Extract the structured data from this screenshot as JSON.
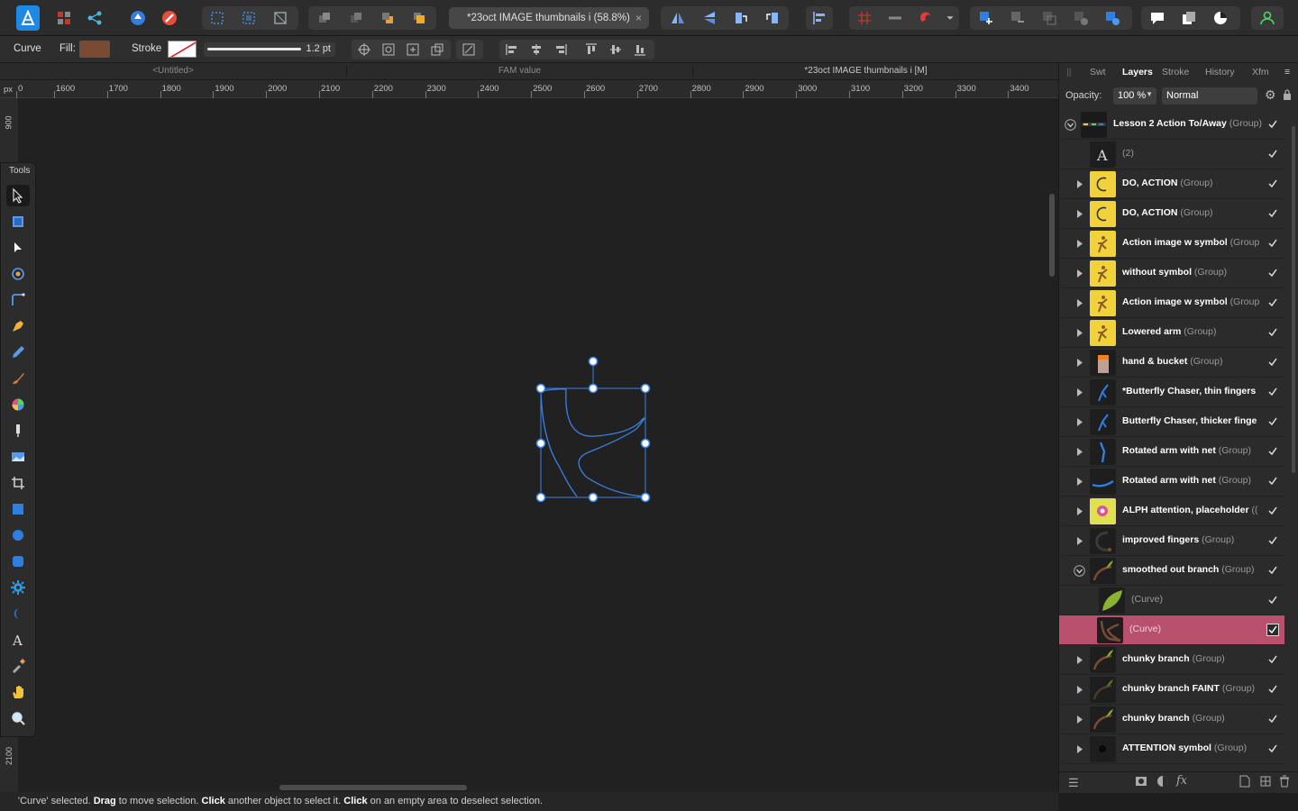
{
  "toolbar": {
    "document_tab": "*23oct IMAGE thumbnails i (58.8%)",
    "close_symbol": "×"
  },
  "context": {
    "tool_label": "Curve",
    "fill_label": "Fill:",
    "stroke_label": "Stroke",
    "stroke_width": "1.2 pt",
    "fill_color": "#7a4a33"
  },
  "doctabs": [
    "<Untitled>",
    "FAM value",
    "*23oct IMAGE thumbnails i [M]"
  ],
  "ruler": {
    "unit": "px",
    "h_ticks": [
      "0",
      "1600",
      "1700",
      "1800",
      "1900",
      "2000",
      "2100",
      "2200",
      "2300",
      "2400",
      "2500",
      "2600",
      "2700",
      "2800",
      "2900",
      "3000",
      "3100",
      "3200",
      "3300",
      "3400"
    ],
    "v_ticks": [
      "900",
      "2100"
    ]
  },
  "tools": {
    "title": "Tools"
  },
  "panel": {
    "tabs": [
      "Swt",
      "Layers",
      "Stroke",
      "History",
      "Xfm"
    ],
    "active_tab": "Layers",
    "opacity_label": "Opacity:",
    "opacity_value": "100 %",
    "blend_mode": "Normal"
  },
  "layers": [
    {
      "name": "Lesson 2 Action To/Away",
      "suffix": "(Group)",
      "expanded": true,
      "indent": 0,
      "thumb": "dark-strip"
    },
    {
      "name": "(2)",
      "suffix": "",
      "expanded": false,
      "indent": 1,
      "thumb": "text",
      "plain": true
    },
    {
      "name": "DO, ACTION",
      "suffix": "(Group)",
      "indent": 1,
      "thumb": "yellow-c"
    },
    {
      "name": "DO, ACTION",
      "suffix": "(Group)",
      "indent": 1,
      "thumb": "yellow-c"
    },
    {
      "name": "Action image w symbol",
      "suffix": "(Group",
      "indent": 1,
      "thumb": "yellow-fig"
    },
    {
      "name": "without symbol",
      "suffix": "(Group)",
      "indent": 1,
      "thumb": "yellow-fig"
    },
    {
      "name": "Action image w symbol",
      "suffix": "(Group",
      "indent": 1,
      "thumb": "yellow-fig"
    },
    {
      "name": "Lowered arm",
      "suffix": "(Group)",
      "indent": 1,
      "thumb": "yellow-fig"
    },
    {
      "name": "hand & bucket",
      "suffix": "(Group)",
      "indent": 1,
      "thumb": "bucket"
    },
    {
      "name": "*Butterfly Chaser, thin fingers",
      "suffix": "",
      "indent": 1,
      "thumb": "blue-fig"
    },
    {
      "name": "Butterfly Chaser, thicker finge",
      "suffix": "",
      "indent": 1,
      "thumb": "blue-fig"
    },
    {
      "name": "Rotated arm with net",
      "suffix": "(Group)",
      "indent": 1,
      "thumb": "blue-arm"
    },
    {
      "name": "Rotated arm with net",
      "suffix": "(Group)",
      "indent": 1,
      "thumb": "blue-arm2"
    },
    {
      "name": "ALPH attention, placeholder",
      "suffix": "((",
      "indent": 1,
      "thumb": "pink"
    },
    {
      "name": "improved fingers",
      "suffix": "(Group)",
      "indent": 1,
      "thumb": "dark-curve"
    },
    {
      "name": "smoothed out branch",
      "suffix": "(Group)",
      "expanded": true,
      "indent": 1,
      "thumb": "branch"
    },
    {
      "name": "(Curve)",
      "suffix": "",
      "indent": 2,
      "thumb": "leaf",
      "plain": true
    },
    {
      "name": "(Curve)",
      "suffix": "",
      "indent": 2,
      "thumb": "branch-brown",
      "plain": true,
      "selected": true
    },
    {
      "name": "chunky branch",
      "suffix": "(Group)",
      "indent": 1,
      "thumb": "branch"
    },
    {
      "name": "chunky branch FAINT",
      "suffix": "(Group)",
      "indent": 1,
      "thumb": "branch-faint"
    },
    {
      "name": "chunky branch",
      "suffix": "(Group)",
      "indent": 1,
      "thumb": "branch"
    },
    {
      "name": "ATTENTION symbol",
      "suffix": "(Group)",
      "indent": 1,
      "thumb": "dot"
    }
  ],
  "status": {
    "text_parts": [
      "'Curve' selected. ",
      "Drag",
      " to move selection. ",
      "Click",
      " another object to select it. ",
      "Click",
      " on an empty area to deselect selection."
    ]
  },
  "colors": {
    "selection_handle": "#3b82e6",
    "selected_layer": "#b8506e",
    "accent": "#1e88e5"
  }
}
